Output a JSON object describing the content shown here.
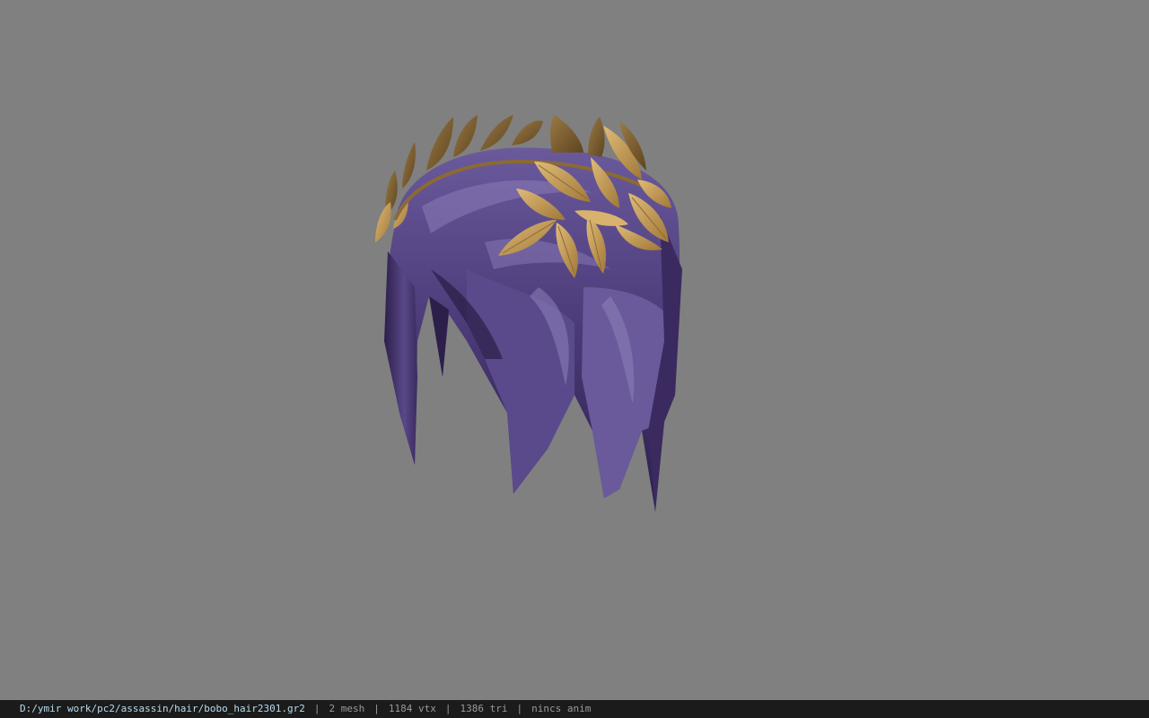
{
  "viewer": {
    "background_color": "#808080",
    "model_colors": {
      "hair": "#4c3a78",
      "hair_dark": "#2c1f4a",
      "hair_light": "#7a6aa5",
      "leaf": "#c9a060",
      "leaf_dark": "#7a5a2c"
    }
  },
  "status_bar": {
    "file_path": "D:/ymir work/pc2/assassin/hair/bobo_hair2301.gr2",
    "separator": "|",
    "mesh_count": "2 mesh",
    "vertex_count": "1184 vtx",
    "triangle_count": "1386 tri",
    "animation": "nincs anim"
  }
}
